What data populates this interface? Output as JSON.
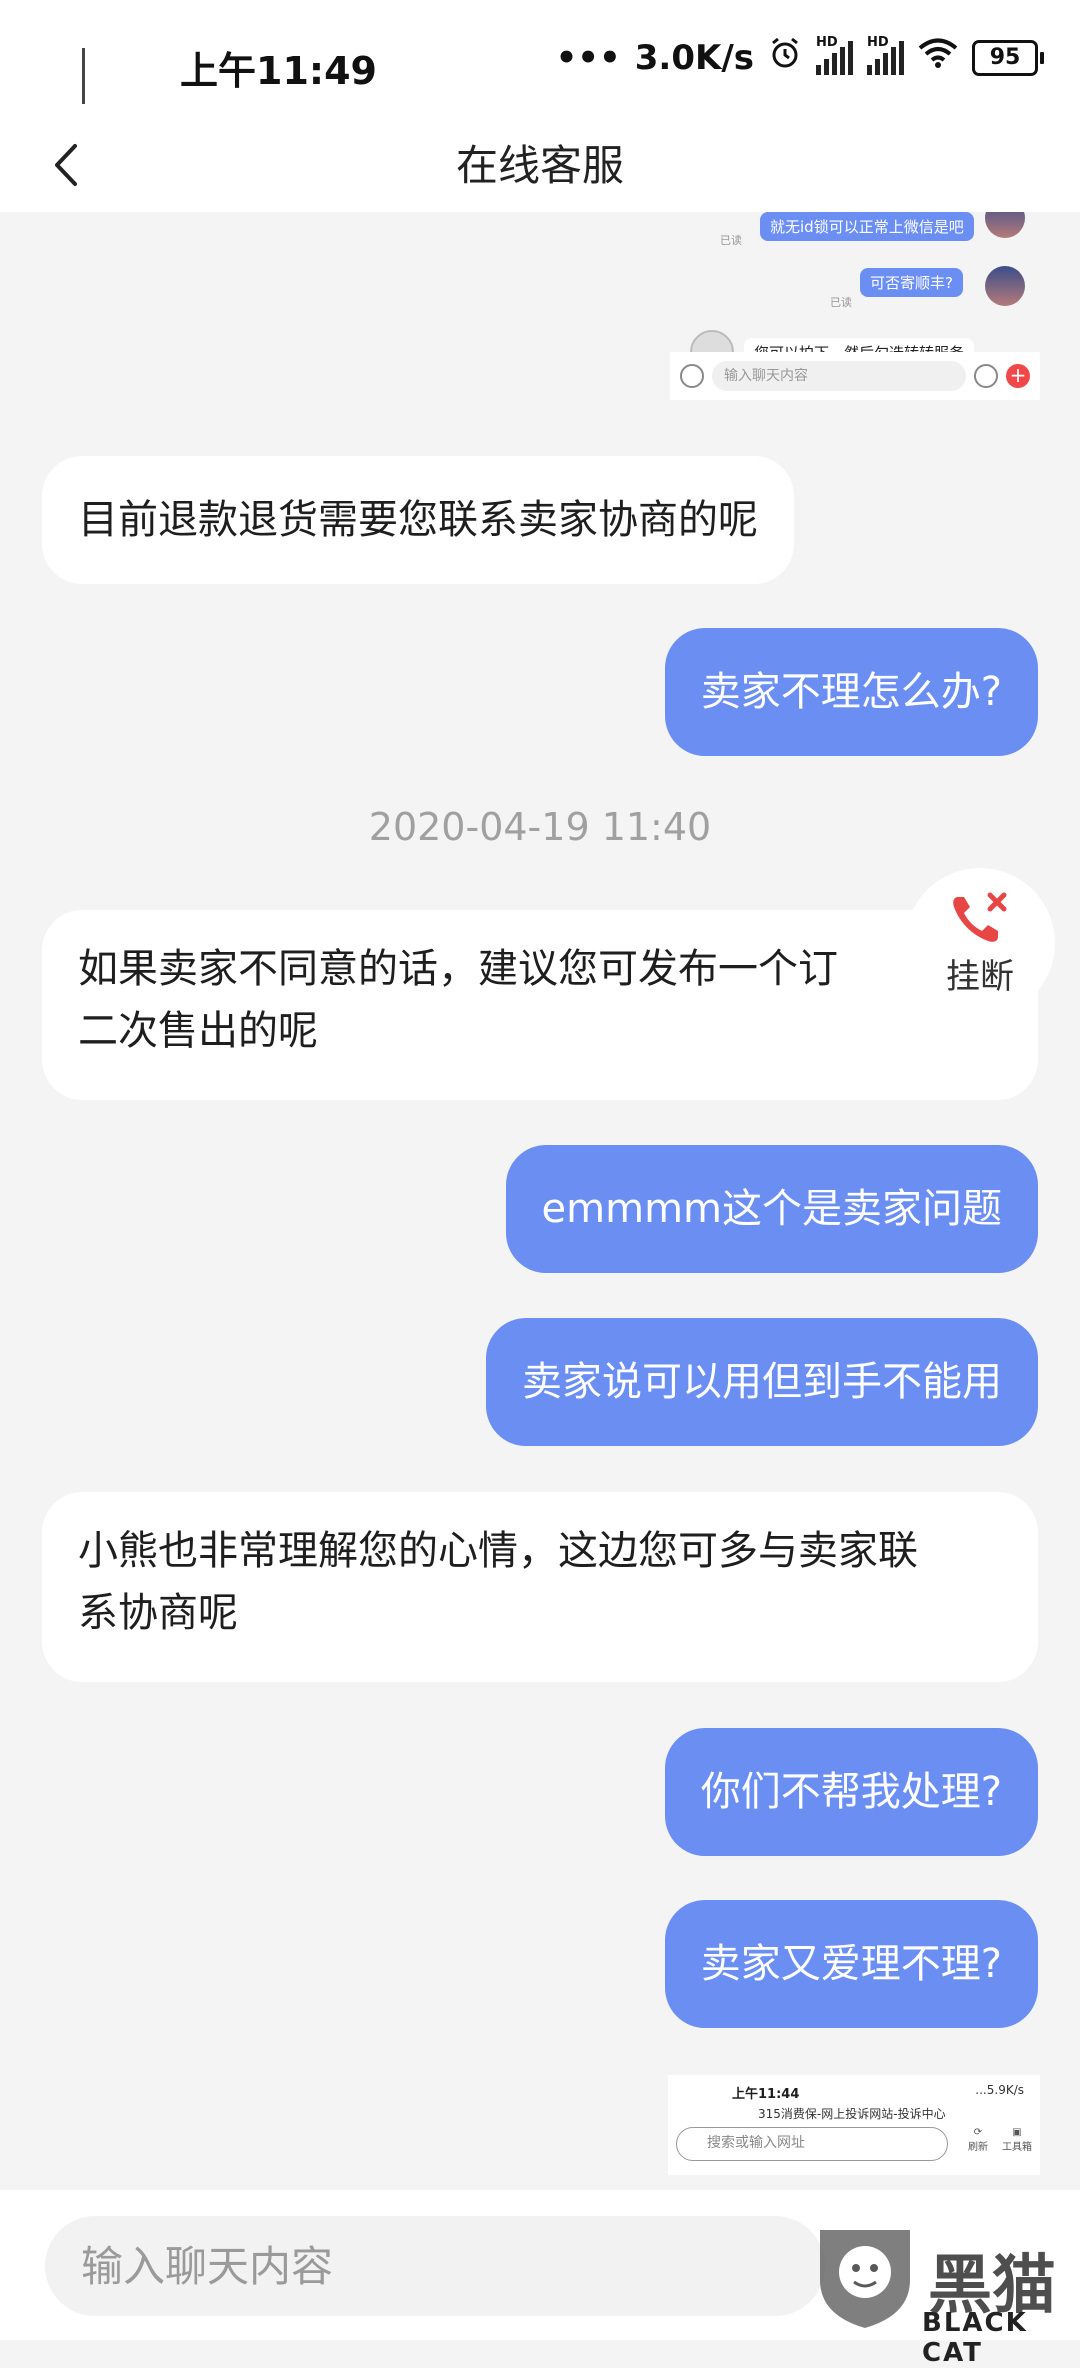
{
  "status_bar": {
    "time": "上午11:49",
    "speed": "3.0K/s",
    "network_1": "HD",
    "network_2": "HD",
    "battery": "95",
    "icons": [
      "more-dots-icon",
      "alarm-icon",
      "signal-icon",
      "signal-icon",
      "wifi-icon",
      "battery-icon"
    ]
  },
  "header": {
    "title": "在线客服",
    "back_icon": "chevron-left-icon"
  },
  "thumbnail_top": {
    "msg1": "就无id锁可以正常上微信是吧",
    "read1": "已读",
    "msg2": "可否寄顺丰?",
    "read2": "已读",
    "msg3": "您可以拍下，然后勾选转转服务",
    "input_placeholder": "输入聊天内容"
  },
  "messages": [
    {
      "side": "left",
      "text": "目前退款退货需要您联系卖家协商的呢"
    },
    {
      "side": "right",
      "text": "卖家不理怎么办?"
    },
    {
      "side": "left",
      "text": "如果卖家不同意的话，建议您可发布一个订单二次售出的呢"
    },
    {
      "side": "right",
      "text": "emmmm这个是卖家问题"
    },
    {
      "side": "right",
      "text": "卖家说可以用但到手不能用"
    },
    {
      "side": "left",
      "text": "小熊也非常理解您的心情，这边您可多与卖家联系协商呢"
    },
    {
      "side": "right",
      "text": "你们不帮我处理?"
    },
    {
      "side": "right",
      "text": "卖家又爱理不理?"
    }
  ],
  "message_lines": {
    "m3_line1": "如果卖家不同意的话，建议您可发布一个订",
    "m3_line2": "二次售出的呢",
    "m6_line1": "小熊也非常理解您的心情，这边您可多与卖家联",
    "m6_line2": "系协商呢"
  },
  "timestamp": "2020-04-19 11:40",
  "hangup": {
    "label": "挂断",
    "icon": "phone-hangup-icon",
    "color": "#e84545"
  },
  "thumbnail_bottom": {
    "time": "上午11:44",
    "status": "...5.9K/s",
    "url": "315消费保-网上投诉网站-投诉中心",
    "search_placeholder": "搜索或输入网址",
    "refresh": "刷新",
    "toolbox": "工具箱"
  },
  "input_bar": {
    "placeholder": "输入聊天内容"
  },
  "watermark": {
    "cn": "黑猫",
    "en": "BLACK CAT"
  },
  "colors": {
    "accent": "#6b8ef3",
    "background": "#f4f4f5",
    "timestamp": "#a0a0a0"
  }
}
